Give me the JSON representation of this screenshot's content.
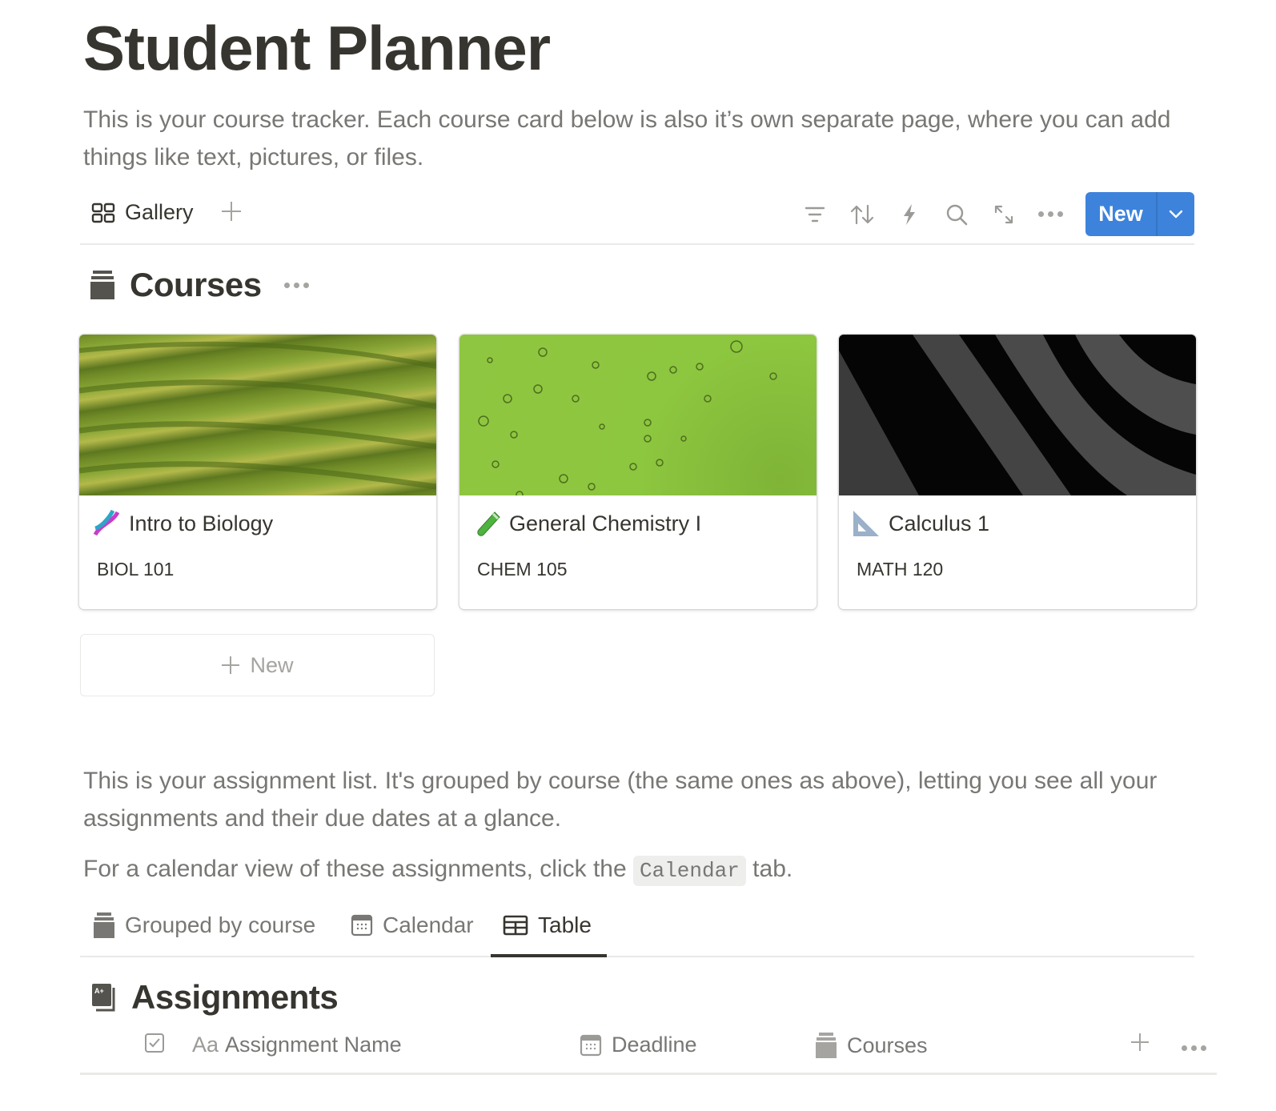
{
  "page": {
    "title": "Student Planner",
    "intro": "This is your course tracker. Each course card below is also it’s own separate page, where you can add things like text, pictures, or files."
  },
  "view_bar": {
    "current_view": "Gallery",
    "current_view_icon": "gallery-icon",
    "add_view_icon": "plus-icon",
    "tools": [
      "filter-icon",
      "sort-icon",
      "automation-bolt-icon",
      "search-icon",
      "expand-icon",
      "more-icon"
    ],
    "new_button": "New",
    "new_dropdown_icon": "chevron-down-icon",
    "accent_color": "#3d83dc"
  },
  "courses_db": {
    "title": "Courses",
    "icon": "cabinet-icon",
    "cards": [
      {
        "emoji": "dna",
        "title": "Intro to Biology",
        "code": "BIOL 101",
        "cover": "green wavy fields"
      },
      {
        "emoji": "test-tube",
        "title": "General Chemistry I",
        "code": "CHEM 105",
        "cover": "green bubbles"
      },
      {
        "emoji": "triangular-ruler",
        "title": "Calculus 1",
        "code": "MATH 120",
        "cover": "black and grey stripes"
      }
    ],
    "add_new": "New"
  },
  "assignments_intro": {
    "line1": "This is your assignment list. It's grouped by course (the same ones as above), letting you see all your assignments and their due dates at a glance.",
    "line2_before": "For a calendar view of these assignments, click the",
    "line2_code": "Calendar",
    "line2_after": "tab."
  },
  "assignment_tabs": [
    {
      "label": "Grouped by course",
      "icon": "cabinet-icon",
      "active": false
    },
    {
      "label": "Calendar",
      "icon": "calendar-icon",
      "active": false
    },
    {
      "label": "Table",
      "icon": "table-icon",
      "active": true
    }
  ],
  "assignments_db": {
    "title": "Assignments",
    "icon": "grade-book-icon",
    "columns": [
      {
        "label": "",
        "icon": "checkbox-icon"
      },
      {
        "label": "Assignment Name",
        "icon": "text-aa-icon",
        "icon_text": "Aa"
      },
      {
        "label": "Deadline",
        "icon": "calendar-icon"
      },
      {
        "label": "Courses",
        "icon": "cabinet-icon"
      }
    ]
  }
}
